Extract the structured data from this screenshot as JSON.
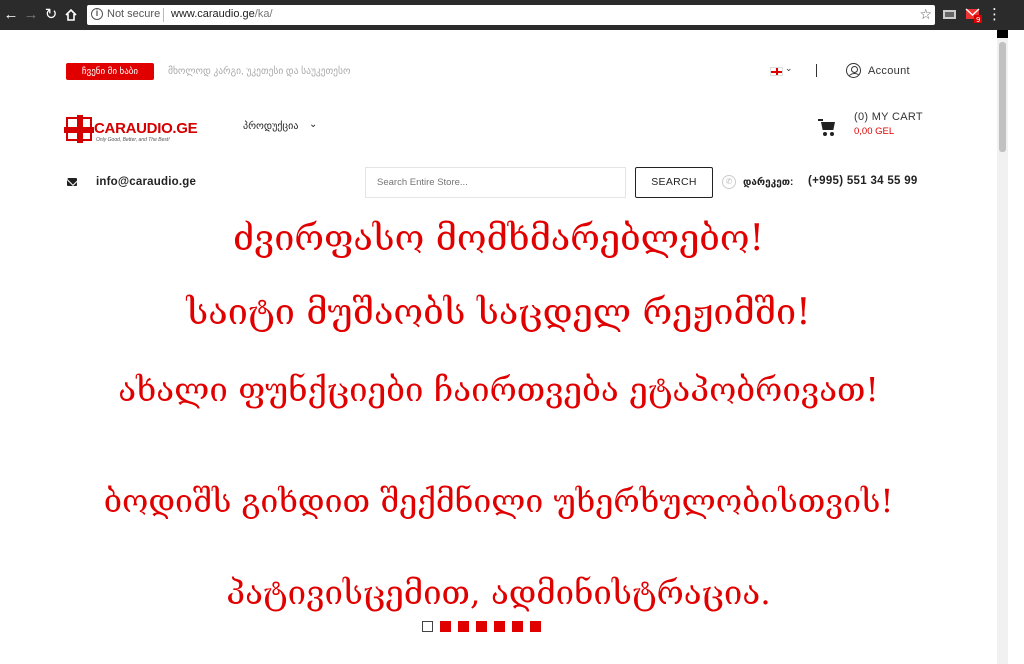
{
  "browser": {
    "security_label": "Not secure",
    "url_host": "www.caraudio.ge",
    "url_path": "/ka/"
  },
  "topbar": {
    "promo_badge": "ჩვენი მი ხაბი",
    "promo_text": "მხოლოდ კარგი, უკეთესი და საუკეთესო",
    "language_icon": "georgian-flag",
    "account_label": "Account"
  },
  "header": {
    "logo_name": "CARAUDIO.GE",
    "logo_tagline": "Only Good, Better, and The Best!",
    "products_menu": "პროდუქცია",
    "cart_label": "(0) MY CART",
    "cart_total": "0,00 GEL"
  },
  "contact": {
    "email": "info@caraudio.ge",
    "call_label": "დარეკეთ:",
    "phone": "(+995) 551 34 55 99"
  },
  "search": {
    "placeholder": "Search Entire Store...",
    "button_label": "SEARCH"
  },
  "notice": {
    "line1": "ძვირფასო მომხმარებლებო!",
    "line2": "საიტი მუშაობს საცდელ რეჟიმში!",
    "line3": "ახალი ფუნქციები ჩაირთვება ეტაპობრივათ!",
    "line4": "ბოდიშს გიხდით შექმნილი უხერხულობისთვის!",
    "line5": "პატივისცემით, ადმინისტრაცია."
  },
  "slider": {
    "total_slides": 7,
    "active_slide": 1
  },
  "colors": {
    "brand_red": "#e10000",
    "chrome_dark": "#2b2b2b"
  }
}
